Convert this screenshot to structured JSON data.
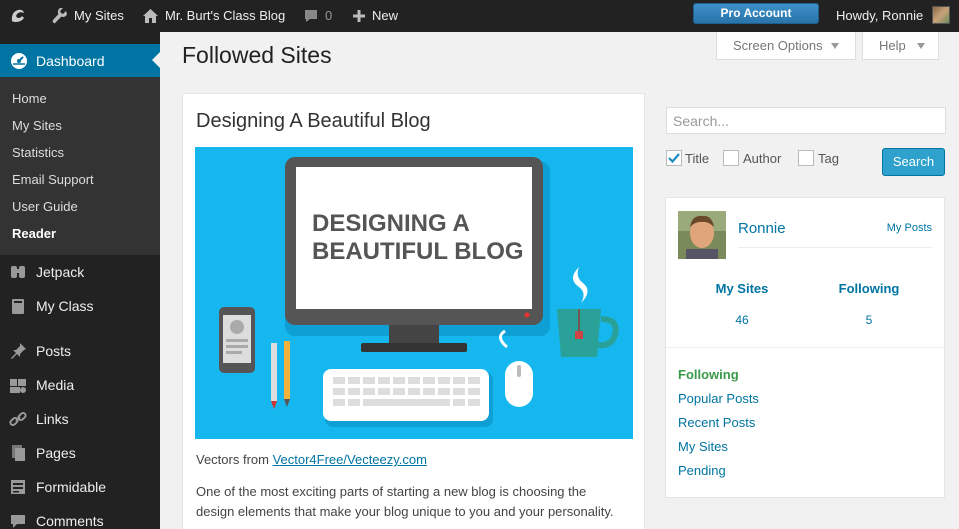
{
  "adminbar": {
    "my_sites": "My Sites",
    "blog_name": "Mr. Burt's Class Blog",
    "comments_count": "0",
    "new_label": "New",
    "pro_account": "Pro Account",
    "howdy": "Howdy, Ronnie"
  },
  "sidebar": {
    "dashboard": "Dashboard",
    "submenu": [
      {
        "label": "Home"
      },
      {
        "label": "My Sites"
      },
      {
        "label": "Statistics"
      },
      {
        "label": "Email Support"
      },
      {
        "label": "User Guide"
      },
      {
        "label": "Reader"
      }
    ],
    "items": [
      {
        "label": "Jetpack",
        "icon": "jetpack-icon"
      },
      {
        "label": "My Class",
        "icon": "book-icon"
      },
      {
        "label": "Posts",
        "icon": "pin-icon"
      },
      {
        "label": "Media",
        "icon": "media-icon"
      },
      {
        "label": "Links",
        "icon": "link-icon"
      },
      {
        "label": "Pages",
        "icon": "pages-icon"
      },
      {
        "label": "Formidable",
        "icon": "form-icon"
      },
      {
        "label": "Comments",
        "icon": "comment-icon"
      }
    ]
  },
  "header": {
    "screen_options": "Screen Options",
    "help": "Help",
    "page_title": "Followed Sites"
  },
  "post": {
    "title": "Designing A Beautiful Blog",
    "image_heading_line1": "DESIGNING A",
    "image_heading_line2": "BEAUTIFUL BLOG",
    "credit_prefix": "Vectors from ",
    "credit_link": "Vector4Free/Vecteezy.com",
    "excerpt": "One of the most exciting parts of starting a new blog is choosing the design elements that make your blog unique to you and your personality."
  },
  "search": {
    "placeholder": "Search...",
    "title_label": "Title",
    "author_label": "Author",
    "tag_label": "Tag",
    "button": "Search"
  },
  "profile": {
    "name": "Ronnie",
    "my_posts": "My Posts",
    "my_sites_label": "My Sites",
    "my_sites_count": "46",
    "following_label": "Following",
    "following_count": "5",
    "nav": [
      {
        "label": "Following"
      },
      {
        "label": "Popular Posts"
      },
      {
        "label": "Recent Posts"
      },
      {
        "label": "My Sites"
      },
      {
        "label": "Pending"
      }
    ]
  },
  "colors": {
    "accent": "#0074a2",
    "button": "#2ea2cc",
    "admin_bar": "#222222",
    "image_bg": "#16b7ee",
    "active_nav": "#3a9a4a"
  }
}
